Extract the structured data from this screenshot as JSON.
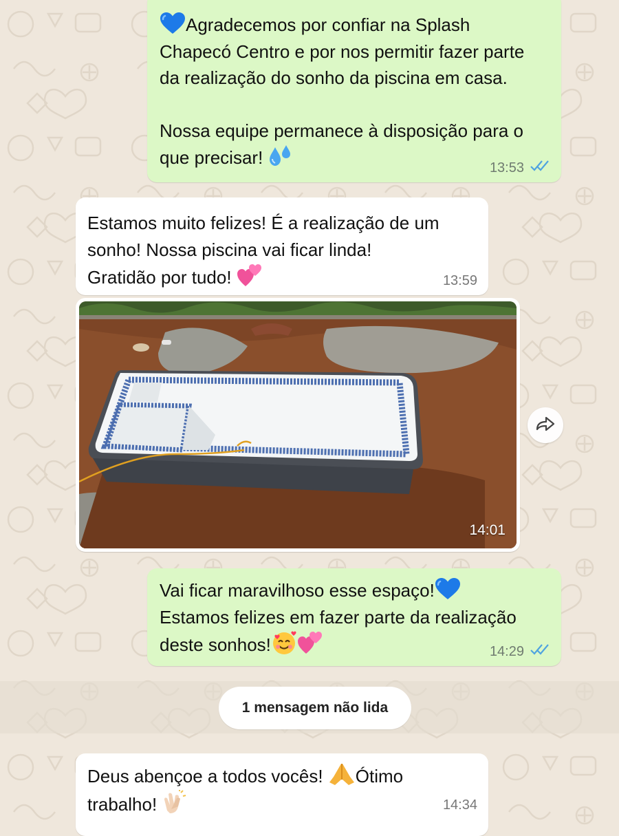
{
  "messages": [
    {
      "direction": "outgoing",
      "lines": [
        "Agradecemos por confiar na Splash",
        "Chapecó Centro e por nos permitir fazer parte",
        "da realização do sonho da piscina em casa.",
        "",
        "Nossa equipe permanece à disposição para o",
        "que precisar!"
      ],
      "emojis": [
        "blue-heart",
        "sweat-droplets"
      ],
      "time": "13:53",
      "status": "read"
    },
    {
      "direction": "incoming",
      "lines": [
        "Estamos muito felizes! É a realização de um",
        "sonho! Nossa piscina vai ficar linda!",
        "Gratidão por tudo!"
      ],
      "emojis": [
        "two-hearts"
      ],
      "time": "13:59"
    },
    {
      "direction": "incoming",
      "type": "image",
      "image_description": "fiberglass pool being installed in dug earth",
      "time": "14:01"
    },
    {
      "direction": "outgoing",
      "lines": [
        "Vai ficar maravilhoso esse espaço!",
        "Estamos felizes em fazer parte da realização",
        "deste sonhos!"
      ],
      "emojis": [
        "blue-heart",
        "smiling-face-with-hearts",
        "two-hearts"
      ],
      "time": "14:29",
      "status": "read"
    },
    {
      "direction": "incoming",
      "lines": [
        "Deus abençoe a todos vocês!",
        "Ótimo",
        "trabalho!"
      ],
      "emojis": [
        "folded-hands",
        "clapping-hands"
      ],
      "time": "14:34"
    }
  ],
  "unread_banner": "1 mensagem não lida",
  "icons": {
    "forward": "forward-icon",
    "read_receipt": "double-check-icon"
  },
  "colors": {
    "outgoing_bubble": "#dcf8c6",
    "incoming_bubble": "#ffffff",
    "read_tick": "#4fa3e0",
    "background": "#efe7dc"
  }
}
